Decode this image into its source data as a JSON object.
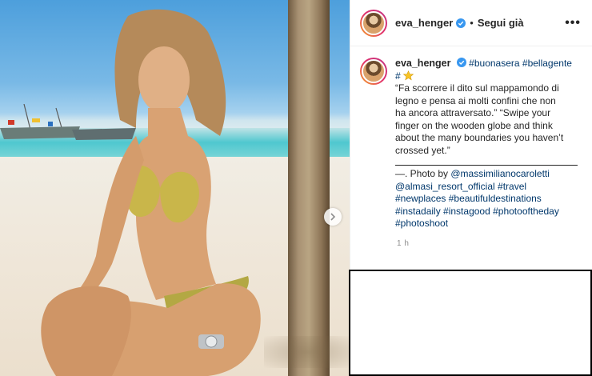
{
  "post": {
    "photo_alt": "",
    "username": "eva_henger",
    "follow_label": "Segui già",
    "more_label": "•••",
    "caption": {
      "username": "eva_henger",
      "hashtags_top": [
        "#buonasera",
        "#bellagente",
        "#"
      ],
      "line1": "“Fa scorrere il dito sul mappamondo di",
      "line2": "legno e pensa ai molti confini che non",
      "line3": "ha ancora attraversato.” “Swipe your",
      "line4": "finger on the wooden globe and think",
      "line5": "about the many boundaries you haven’t",
      "line6": "crossed yet.”",
      "credit_prefix": "—. Photo by ",
      "mention1": "@massimilianocaroletti",
      "mention2": "@almasi_resort_official",
      "tags_line2": [
        "#travel"
      ],
      "tags_line3": [
        "#newplaces",
        "#beautifuldestinations"
      ],
      "tags_line4": [
        "#instadaily",
        "#instagood",
        "#photooftheday"
      ],
      "tags_line5": [
        "#photoshoot"
      ]
    },
    "timestamp": "1 h"
  },
  "colors": {
    "hashtag": "#00376b",
    "text": "#262626",
    "muted": "#8e8e8e",
    "verified": "#3897f0"
  },
  "icons": [
    "verified-badge-icon",
    "star-emoji-icon",
    "chevron-right-icon",
    "more-options-icon"
  ]
}
